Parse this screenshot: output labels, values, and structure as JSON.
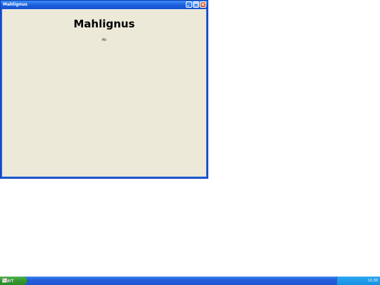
{
  "window": {
    "title": "Mahlignus",
    "heading": "Mahlignus",
    "subtext": "Ab"
  },
  "taskbar": {
    "start_label": "start",
    "clock": "11:30"
  },
  "icons": {
    "minimize": "minimize-icon",
    "maximize": "maximize-icon",
    "close": "close-icon",
    "start_logo": "broken-image-icon"
  },
  "colors": {
    "window_client": "#ece9d8",
    "title_bar": "#1a5ddc",
    "taskbar": "#245edb",
    "start_button": "#33982f",
    "tray": "#1690e3"
  }
}
